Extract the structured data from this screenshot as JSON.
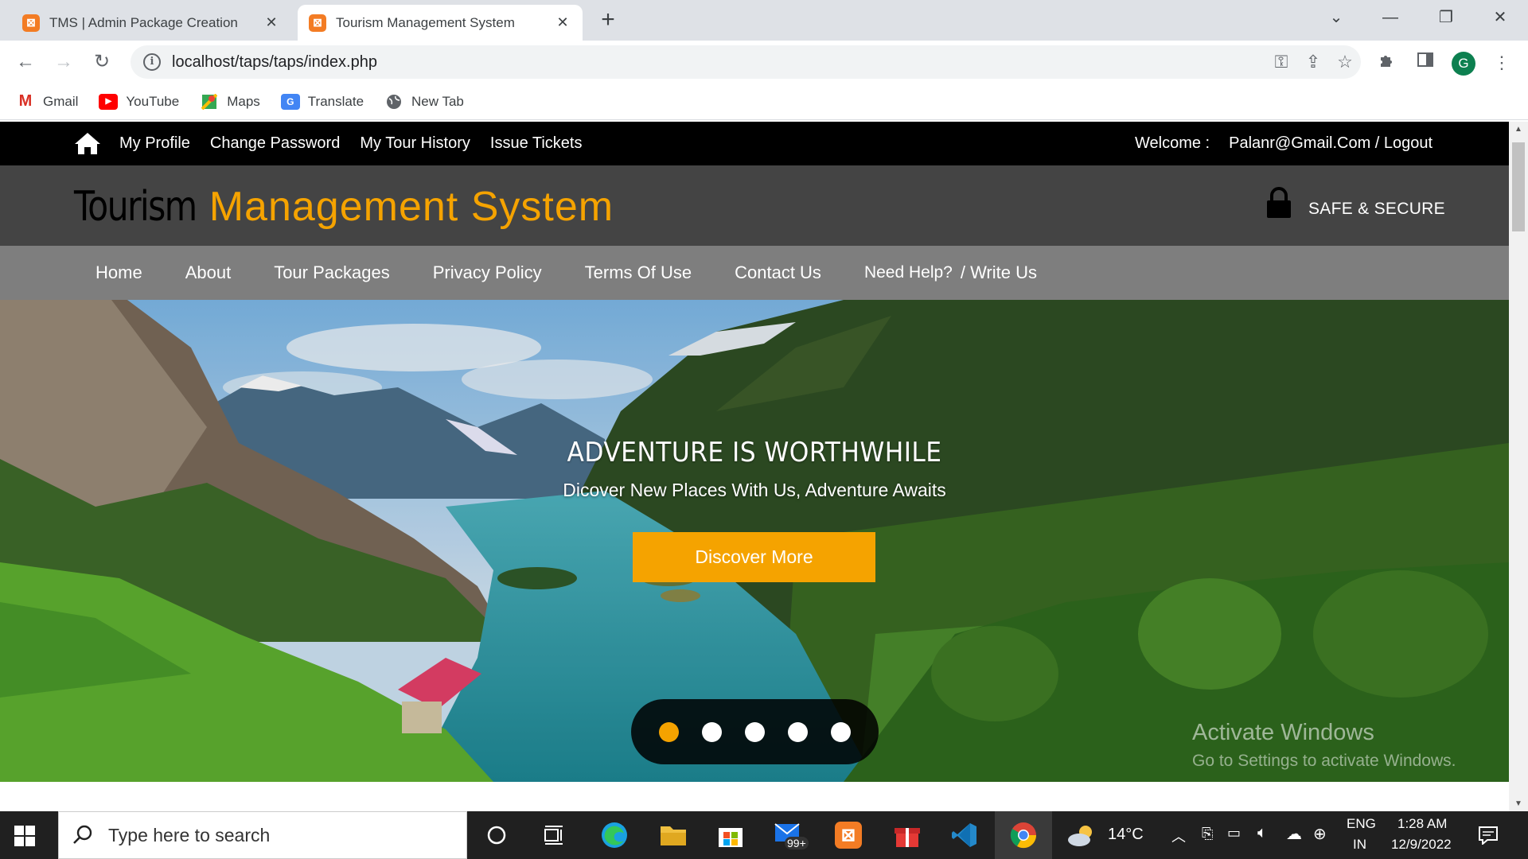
{
  "browser": {
    "tabs": [
      {
        "title": "TMS | Admin Package Creation",
        "active": false
      },
      {
        "title": "Tourism Management System",
        "active": true
      }
    ],
    "url": "localhost/taps/taps/index.php",
    "profile_initial": "G",
    "bookmarks": [
      {
        "label": "Gmail",
        "icon": "gmail-icon"
      },
      {
        "label": "YouTube",
        "icon": "youtube-icon"
      },
      {
        "label": "Maps",
        "icon": "maps-icon"
      },
      {
        "label": "Translate",
        "icon": "translate-icon"
      },
      {
        "label": "New Tab",
        "icon": "globe-icon"
      }
    ]
  },
  "site": {
    "topbar": {
      "links": [
        "My Profile",
        "Change Password",
        "My Tour History",
        "Issue Tickets"
      ],
      "welcome_label": "Welcome :",
      "user_logout": "Palanr@Gmail.Com / Logout"
    },
    "brand": {
      "part1": "Tourism",
      "part2": "Management System",
      "safe_label": "SAFE & SECURE"
    },
    "nav": {
      "items": [
        "Home",
        "About",
        "Tour Packages",
        "Privacy Policy",
        "Terms Of Use",
        "Contact Us"
      ],
      "help": "Need Help?",
      "write": "/ Write Us"
    },
    "hero": {
      "title": "ADVENTURE IS WORTHWHILE",
      "subtitle": "Dicover New Places With Us, Adventure Awaits",
      "button": "Discover More",
      "slides": 5,
      "active_slide": 1
    },
    "watermark": {
      "line1": "Activate Windows",
      "line2": "Go to Settings to activate Windows."
    }
  },
  "taskbar": {
    "search_placeholder": "Type here to search",
    "mail_badge": "99+",
    "weather": "14°C",
    "lang1": "ENG",
    "lang2": "IN",
    "time": "1:28 AM",
    "date": "12/9/2022"
  },
  "colors": {
    "accent": "#f5a300",
    "topbar": "#000000",
    "brandbar": "#444444",
    "navbar": "#7e7e7e"
  }
}
